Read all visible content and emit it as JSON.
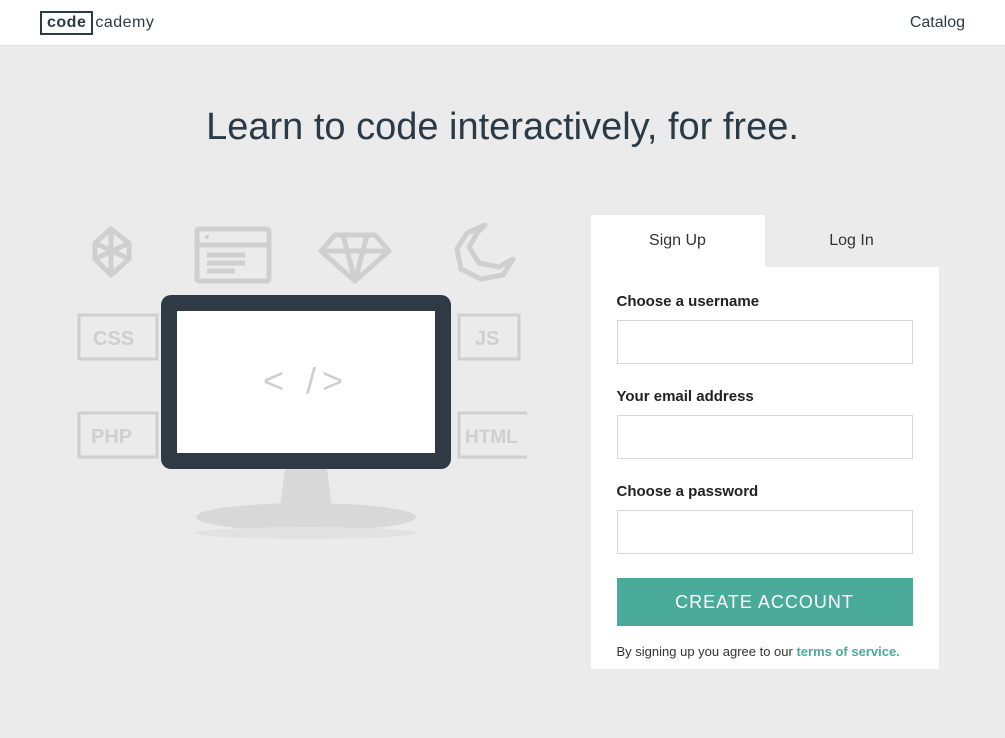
{
  "header": {
    "logo_prefix": "code",
    "logo_suffix": "cademy",
    "nav_catalog": "Catalog"
  },
  "hero": {
    "headline": "Learn to code interactively, for free."
  },
  "auth": {
    "tab_signup": "Sign Up",
    "tab_login": "Log In",
    "username_label": "Choose a username",
    "email_label": "Your email address",
    "password_label": "Choose a password",
    "submit_label": "CREATE ACCOUNT",
    "consent_prefix": "By signing up you agree to our ",
    "consent_link": "terms of service."
  },
  "illustration": {
    "labels": {
      "css": "CSS",
      "php": "PHP",
      "js": "JS",
      "html": "HTML"
    },
    "screen_text": "< />"
  }
}
